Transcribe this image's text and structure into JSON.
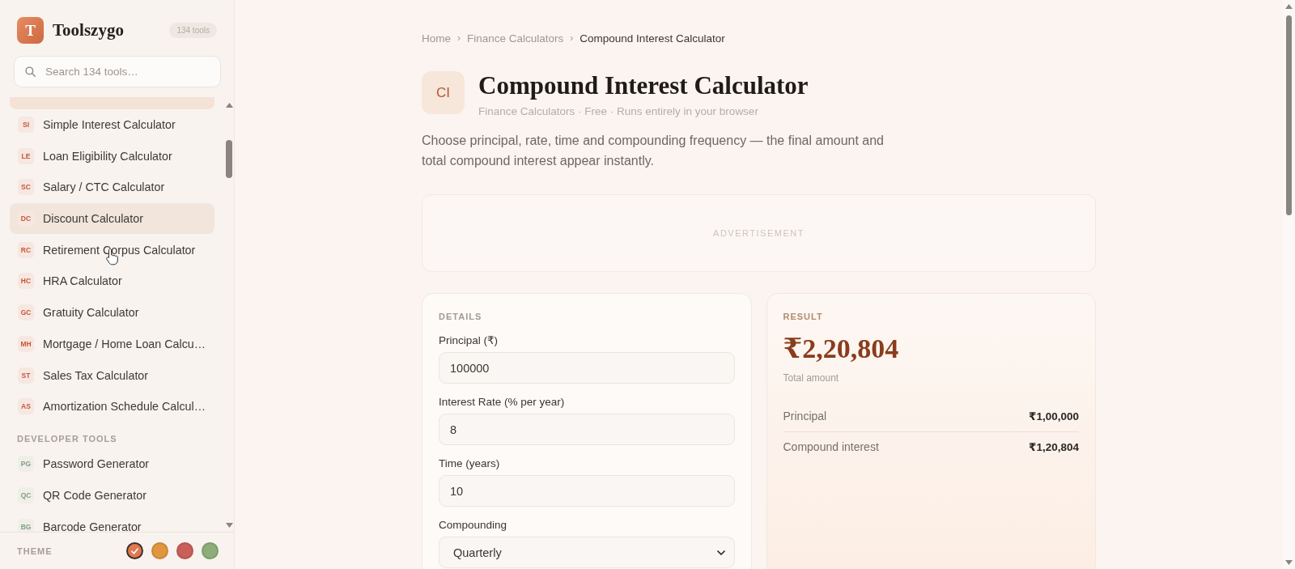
{
  "sidebar": {
    "logo": {
      "letter": "T",
      "name": "Toolszygo",
      "count": "134 tools"
    },
    "search": {
      "placeholder": "Search 134 tools…"
    },
    "clipped_row": {
      "selected": true
    },
    "sections": [
      {
        "color": "#c8563a",
        "items": [
          {
            "abbr": "SI",
            "label": "Simple Interest Calculator",
            "hovered": false
          },
          {
            "abbr": "LE",
            "label": "Loan Eligibility Calculator",
            "hovered": false
          },
          {
            "abbr": "SC",
            "label": "Salary / CTC Calculator",
            "hovered": false
          },
          {
            "abbr": "DC",
            "label": "Discount Calculator",
            "hovered": true
          },
          {
            "abbr": "RC",
            "label": "Retirement Corpus Calculator",
            "hovered": false
          },
          {
            "abbr": "HC",
            "label": "HRA Calculator",
            "hovered": false
          },
          {
            "abbr": "GC",
            "label": "Gratuity Calculator",
            "hovered": false
          },
          {
            "abbr": "MH",
            "label": "Mortgage / Home Loan Calcu…",
            "hovered": false
          },
          {
            "abbr": "ST",
            "label": "Sales Tax Calculator",
            "hovered": false
          },
          {
            "abbr": "AS",
            "label": "Amortization Schedule Calcul…",
            "hovered": false
          }
        ]
      },
      {
        "title": "DEVELOPER TOOLS",
        "color": "#84a080",
        "items": [
          {
            "abbr": "PG",
            "label": "Password Generator",
            "hovered": false
          },
          {
            "abbr": "QC",
            "label": "QR Code Generator",
            "hovered": false
          },
          {
            "abbr": "BG",
            "label": "Barcode Generator",
            "hovered": false
          }
        ]
      }
    ],
    "theme": {
      "label": "THEME",
      "swatches": [
        {
          "color": "#e07850",
          "selected": true
        },
        {
          "color": "#e0963f",
          "selected": false
        },
        {
          "color": "#c95f5a",
          "selected": false
        },
        {
          "color": "#8dae7a",
          "selected": false
        }
      ]
    }
  },
  "main": {
    "breadcrumb": {
      "separator": "›",
      "items": [
        {
          "label": "Home",
          "current": false
        },
        {
          "label": "Finance Calculators",
          "current": false
        },
        {
          "label": "Compound Interest Calculator",
          "current": true
        }
      ]
    },
    "header": {
      "icon": "CI",
      "title": "Compound Interest Calculator",
      "meta": "Finance Calculators · Free · Runs entirely in your browser"
    },
    "description": "Choose principal, rate, time and compounding frequency — the final amount and total compound interest appear instantly.",
    "ad": {
      "label": "ADVERTISEMENT"
    },
    "details": {
      "heading": "DETAILS",
      "fields": [
        {
          "kind": "input",
          "label": "Principal (₹)",
          "value": "100000"
        },
        {
          "kind": "input",
          "label": "Interest Rate (% per year)",
          "value": "8"
        },
        {
          "kind": "input",
          "label": "Time (years)",
          "value": "10"
        },
        {
          "kind": "select",
          "label": "Compounding",
          "value": "Quarterly"
        }
      ]
    },
    "result": {
      "heading": "RESULT",
      "total": "₹2,20,804",
      "total_label": "Total amount",
      "rows": [
        {
          "label": "Principal",
          "value": "₹1,00,000"
        },
        {
          "label": "Compound interest",
          "value": "₹1,20,804"
        }
      ]
    }
  }
}
